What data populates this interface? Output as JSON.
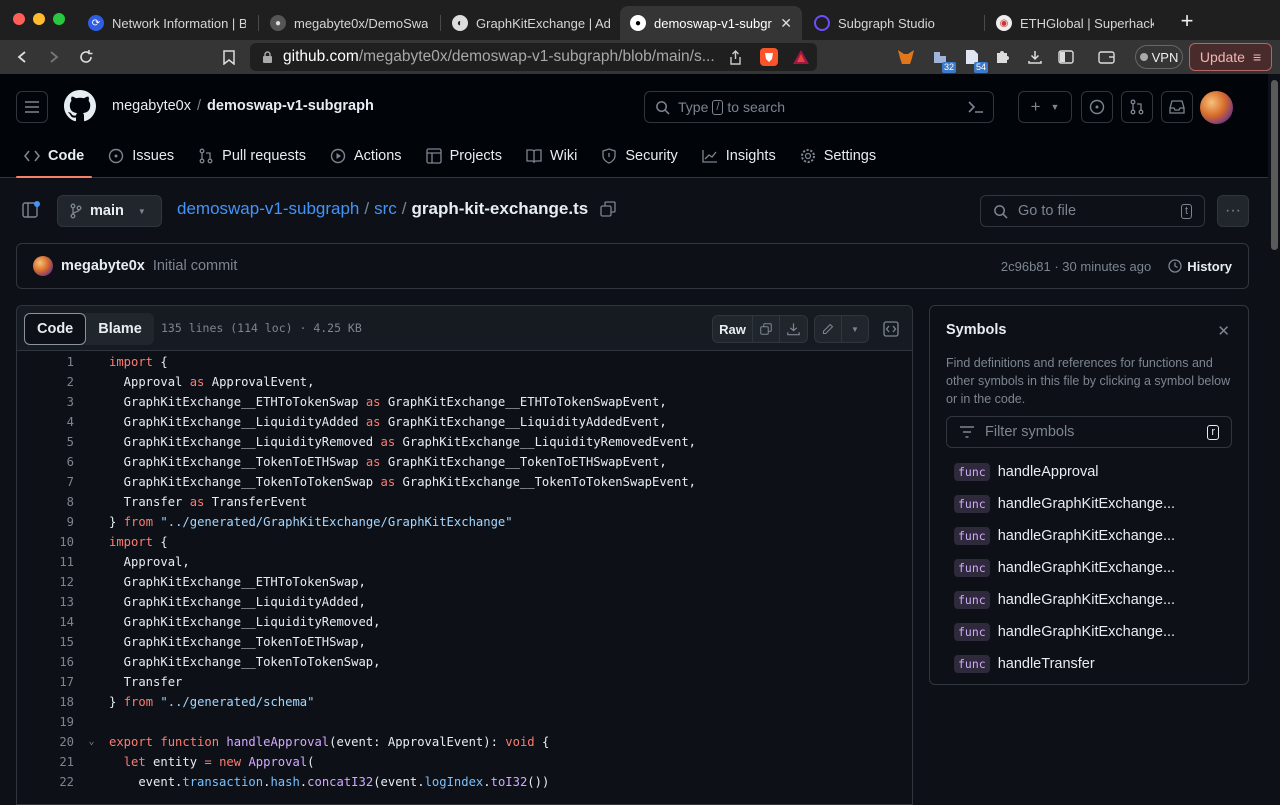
{
  "browser": {
    "tabs": [
      {
        "title": "Network Information | Bas",
        "icon": "network-icon"
      },
      {
        "title": "megabyte0x/DemoSwap-",
        "icon": "github-icon"
      },
      {
        "title": "GraphKitExchange | Addr",
        "icon": "etherscan-icon"
      },
      {
        "title": "demoswap-v1-subgrap",
        "icon": "github-icon"
      },
      {
        "title": "Subgraph Studio",
        "icon": "thegraph-icon"
      },
      {
        "title": "ETHGlobal | Superhack",
        "icon": "ethglobal-icon"
      }
    ],
    "url_host": "github.com",
    "url_path": "/megabyte0x/demoswap-v1-subgraph/blob/main/s...",
    "extension_badges": [
      "32",
      "54"
    ],
    "vpn_label": "VPN",
    "update_label": "Update"
  },
  "github": {
    "owner": "megabyte0x",
    "repo": "demoswap-v1-subgraph",
    "search_prefix": "Type",
    "search_key": "/",
    "search_suffix": "to search",
    "nav": [
      "Code",
      "Issues",
      "Pull requests",
      "Actions",
      "Projects",
      "Wiki",
      "Security",
      "Insights",
      "Settings"
    ]
  },
  "file": {
    "branch": "main",
    "crumb_repo": "demoswap-v1-subgraph",
    "crumb_dir": "src",
    "filename": "graph-kit-exchange.ts",
    "goto_placeholder": "Go to file",
    "goto_key": "t",
    "commit_author": "megabyte0x",
    "commit_message": "Initial commit",
    "commit_sha_time": "2c96b81 · 30 minutes ago",
    "history_label": "History",
    "view_code": "Code",
    "view_blame": "Blame",
    "file_info": "135 lines (114 loc) · 4.25 KB",
    "raw_label": "Raw"
  },
  "code_lines": [
    {
      "n": "1",
      "fold": "",
      "html": "<span class='kw'>import</span> {"
    },
    {
      "n": "2",
      "fold": "",
      "html": "  Approval <span class='kw'>as</span> ApprovalEvent,"
    },
    {
      "n": "3",
      "fold": "",
      "html": "  GraphKitExchange__ETHToTokenSwap <span class='kw'>as</span> GraphKitExchange__ETHToTokenSwapEvent,"
    },
    {
      "n": "4",
      "fold": "",
      "html": "  GraphKitExchange__LiquidityAdded <span class='kw'>as</span> GraphKitExchange__LiquidityAddedEvent,"
    },
    {
      "n": "5",
      "fold": "",
      "html": "  GraphKitExchange__LiquidityRemoved <span class='kw'>as</span> GraphKitExchange__LiquidityRemovedEvent,"
    },
    {
      "n": "6",
      "fold": "",
      "html": "  GraphKitExchange__TokenToETHSwap <span class='kw'>as</span> GraphKitExchange__TokenToETHSwapEvent,"
    },
    {
      "n": "7",
      "fold": "",
      "html": "  GraphKitExchange__TokenToTokenSwap <span class='kw'>as</span> GraphKitExchange__TokenToTokenSwapEvent,"
    },
    {
      "n": "8",
      "fold": "",
      "html": "  Transfer <span class='kw'>as</span> TransferEvent"
    },
    {
      "n": "9",
      "fold": "",
      "html": "} <span class='kw'>from</span> <span class='str'>\"../generated/GraphKitExchange/GraphKitExchange\"</span>"
    },
    {
      "n": "10",
      "fold": "",
      "html": "<span class='kw'>import</span> {"
    },
    {
      "n": "11",
      "fold": "",
      "html": "  Approval,"
    },
    {
      "n": "12",
      "fold": "",
      "html": "  GraphKitExchange__ETHToTokenSwap,"
    },
    {
      "n": "13",
      "fold": "",
      "html": "  GraphKitExchange__LiquidityAdded,"
    },
    {
      "n": "14",
      "fold": "",
      "html": "  GraphKitExchange__LiquidityRemoved,"
    },
    {
      "n": "15",
      "fold": "",
      "html": "  GraphKitExchange__TokenToETHSwap,"
    },
    {
      "n": "16",
      "fold": "",
      "html": "  GraphKitExchange__TokenToTokenSwap,"
    },
    {
      "n": "17",
      "fold": "",
      "html": "  Transfer"
    },
    {
      "n": "18",
      "fold": "",
      "html": "} <span class='kw'>from</span> <span class='str'>\"../generated/schema\"</span>"
    },
    {
      "n": "19",
      "fold": "",
      "html": ""
    },
    {
      "n": "20",
      "fold": "⌄",
      "html": "<span class='kw'>export</span> <span class='kw'>function</span> <span class='fn'>handleApproval</span>(event: ApprovalEvent): <span class='kw'>void</span> {"
    },
    {
      "n": "21",
      "fold": "",
      "html": "  <span class='kw'>let</span> entity <span class='kw'>=</span> <span class='kw'>new</span> <span class='fn'>Approval</span>("
    },
    {
      "n": "22",
      "fold": "",
      "html": "    event.<span class='pr'>transaction</span>.<span class='pr'>hash</span>.<span class='fn'>concatI32</span>(event.<span class='pr'>logIndex</span>.<span class='fn'>toI32</span>())"
    }
  ],
  "symbols": {
    "title": "Symbols",
    "description": "Find definitions and references for functions and other symbols in this file by clicking a symbol below or in the code.",
    "filter_placeholder": "Filter symbols",
    "filter_key": "r",
    "badge": "func",
    "items": [
      "handleApproval",
      "handleGraphKitExchange...",
      "handleGraphKitExchange...",
      "handleGraphKitExchange...",
      "handleGraphKitExchange...",
      "handleGraphKitExchange...",
      "handleTransfer"
    ]
  }
}
